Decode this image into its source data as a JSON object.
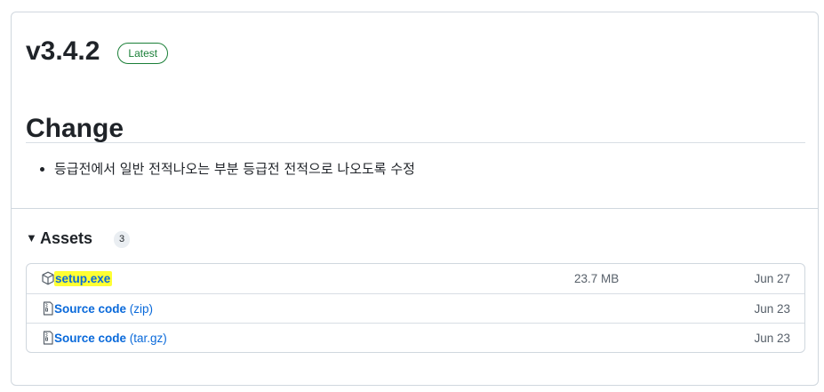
{
  "release": {
    "title": "v3.4.2",
    "badge": "Latest"
  },
  "notes": {
    "heading": "Change",
    "items": [
      "등급전에서 일반 전적나오는 부분 등급전 전적으로 나오도록 수정"
    ]
  },
  "assets": {
    "label": "Assets",
    "count": "3",
    "rows": [
      {
        "name": "setup.exe",
        "suffix": "",
        "size": "23.7 MB",
        "date": "Jun 27",
        "icon": "package-icon",
        "highlighted": true
      },
      {
        "name": "Source code",
        "suffix": "(zip)",
        "size": "",
        "date": "Jun 23",
        "icon": "file-zip-icon",
        "highlighted": false
      },
      {
        "name": "Source code",
        "suffix": "(tar.gz)",
        "size": "",
        "date": "Jun 23",
        "icon": "file-zip-icon",
        "highlighted": false
      }
    ]
  },
  "colors": {
    "link": "#0969da",
    "latest_green": "#1a7f37",
    "highlight": "#ffff33",
    "border": "#d0d7de"
  }
}
